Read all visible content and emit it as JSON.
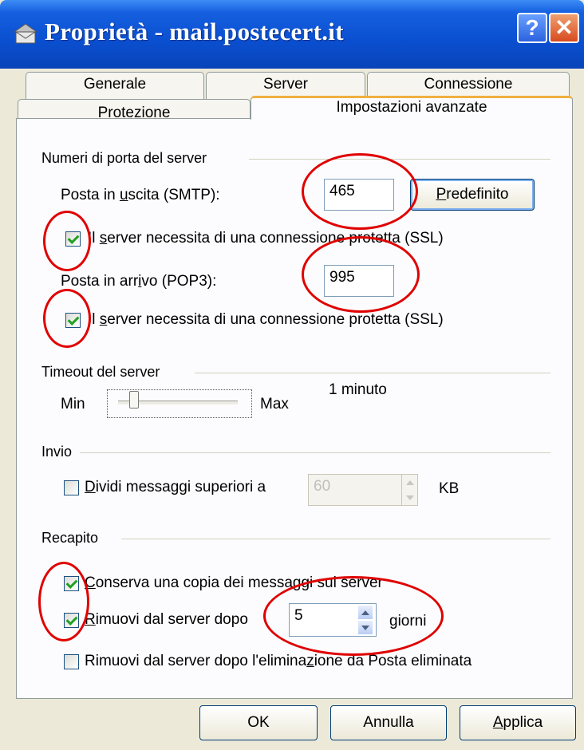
{
  "window": {
    "title": "Proprietà - mail.postecert.it",
    "help_glyph": "?",
    "close_glyph": "✕"
  },
  "tabs": {
    "row1": [
      "Generale",
      "Server",
      "Connessione"
    ],
    "row2": [
      "Protezione",
      "Impostazioni avanzate"
    ],
    "active": "Impostazioni avanzate"
  },
  "ports": {
    "group_label": "Numeri di porta del server",
    "smtp_label_pre": "Posta in ",
    "smtp_label_u": "u",
    "smtp_label_post": "scita (SMTP):",
    "smtp_value": "465",
    "default_button_u": "P",
    "default_button_rest": "redefinito",
    "ssl_smtp_pre": "Il ",
    "ssl_smtp_u": "s",
    "ssl_smtp_post": "erver necessita di una connessione protetta (SSL)",
    "ssl_smtp_checked": true,
    "pop3_label_pre": "Posta in arr",
    "pop3_label_u": "i",
    "pop3_label_post": "vo (POP3):",
    "pop3_value": "995",
    "ssl_pop3_pre": "Il ",
    "ssl_pop3_u": "s",
    "ssl_pop3_post": "erver necessita di una connessione protetta (SSL)",
    "ssl_pop3_checked": true
  },
  "timeout": {
    "group_label": "Timeout del server",
    "min_label": "Min",
    "max_label": "Max",
    "value_text": "1 minuto",
    "slider_level": 0.1
  },
  "invio": {
    "group_label": "Invio",
    "split_u": "D",
    "split_rest": "ividi messaggi superiori a",
    "split_checked": false,
    "split_value": "60",
    "unit": "KB"
  },
  "recapito": {
    "group_label": "Recapito",
    "keep_u": "C",
    "keep_rest": "onserva una copia dei messaggi sul server",
    "keep_checked": true,
    "remove_after_u": "R",
    "remove_after_rest": "imuovi dal server dopo",
    "remove_after_checked": true,
    "days_value": "5",
    "days_unit": "giorni",
    "remove_deleted_pre": "Rimuovi dal server dopo l'elimina",
    "remove_deleted_u": "z",
    "remove_deleted_post": "ione da Posta eliminata",
    "remove_deleted_checked": false
  },
  "footer": {
    "ok": "OK",
    "cancel": "Annulla",
    "apply_u": "A",
    "apply_rest": "pplica"
  },
  "annotation_color": "#e00000"
}
